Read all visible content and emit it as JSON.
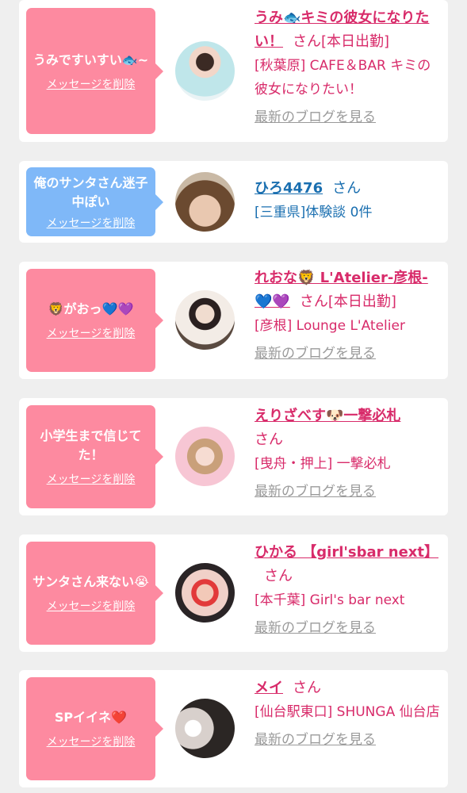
{
  "delete_label": "メッセージを削除",
  "blog_label": "最新のブログを見る",
  "san": "さん",
  "cards": [
    {
      "message": "うみですいすい🐟~",
      "message2": "~",
      "name": "うみ🐟キミの彼女になりたい！",
      "status": "[本日出勤]",
      "location": "[秋葉原] CAFE＆BAR キミの彼女になりたい！"
    },
    {
      "message": "俺のサンタさん迷子中ぽい",
      "name": "ひろ4476",
      "location": "[三重県]体験談 0件"
    },
    {
      "message": "🦁がおっ💙💜",
      "name": "れおな🦁 L'Atelier-彦根-💙💜",
      "status": "[本日出勤]",
      "location": "[彦根] Lounge L'Atelier"
    },
    {
      "message": "小学生まで信じてた！",
      "name": "えりざべす🐶一撃必札",
      "location": "[曳舟・押上] 一撃必札"
    },
    {
      "message": "サンタさん来ない😭",
      "name": "ひかる 【girl'sbar next】",
      "location": "[本千葉] Girl's bar next"
    },
    {
      "message": "SPイイネ❤️",
      "name": "メイ",
      "location": "[仙台駅東口] SHUNGA 仙台店"
    }
  ],
  "colors": {
    "pink_bubble": "#fd8aa0",
    "blue_bubble": "#7fb8f8",
    "pink_text": "#d82b6a",
    "blue_text": "#1a6fb0",
    "muted": "#9a9a9a",
    "background": "#efefef"
  }
}
